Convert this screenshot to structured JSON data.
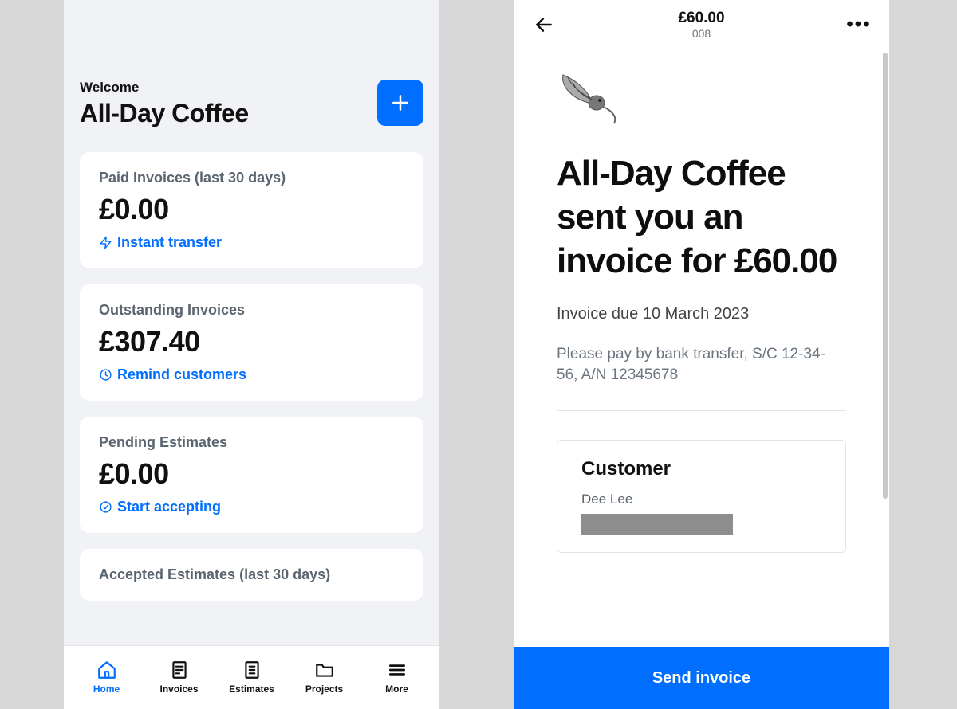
{
  "colors": {
    "accent": "#006fff"
  },
  "left": {
    "welcome": "Welcome",
    "business_name": "All-Day Coffee",
    "add_icon": "plus-icon",
    "cards": [
      {
        "label": "Paid Invoices (last 30 days)",
        "value": "£0.00",
        "action": "Instant transfer",
        "action_icon": "lightning-icon"
      },
      {
        "label": "Outstanding Invoices",
        "value": "£307.40",
        "action": "Remind customers",
        "action_icon": "clock-icon"
      },
      {
        "label": "Pending Estimates",
        "value": "£0.00",
        "action": "Start accepting",
        "action_icon": "check-circle-icon"
      },
      {
        "label": "Accepted Estimates (last 30 days)",
        "value": "",
        "action": "",
        "action_icon": ""
      }
    ],
    "tabs": [
      {
        "label": "Home",
        "icon": "home-icon",
        "active": true
      },
      {
        "label": "Invoices",
        "icon": "invoice-icon",
        "active": false
      },
      {
        "label": "Estimates",
        "icon": "estimate-icon",
        "active": false
      },
      {
        "label": "Projects",
        "icon": "folder-icon",
        "active": false
      },
      {
        "label": "More",
        "icon": "menu-icon",
        "active": false
      }
    ]
  },
  "right": {
    "header": {
      "amount": "£60.00",
      "invoice_no": "008"
    },
    "title": "All-Day Coffee sent you an invoice for £60.00",
    "due": "Invoice due 10 March 2023",
    "instructions": "Please pay by bank transfer, S/C 12-34-56, A/N 12345678",
    "customer": {
      "heading": "Customer",
      "name": "Dee Lee"
    },
    "send_label": "Send invoice"
  }
}
